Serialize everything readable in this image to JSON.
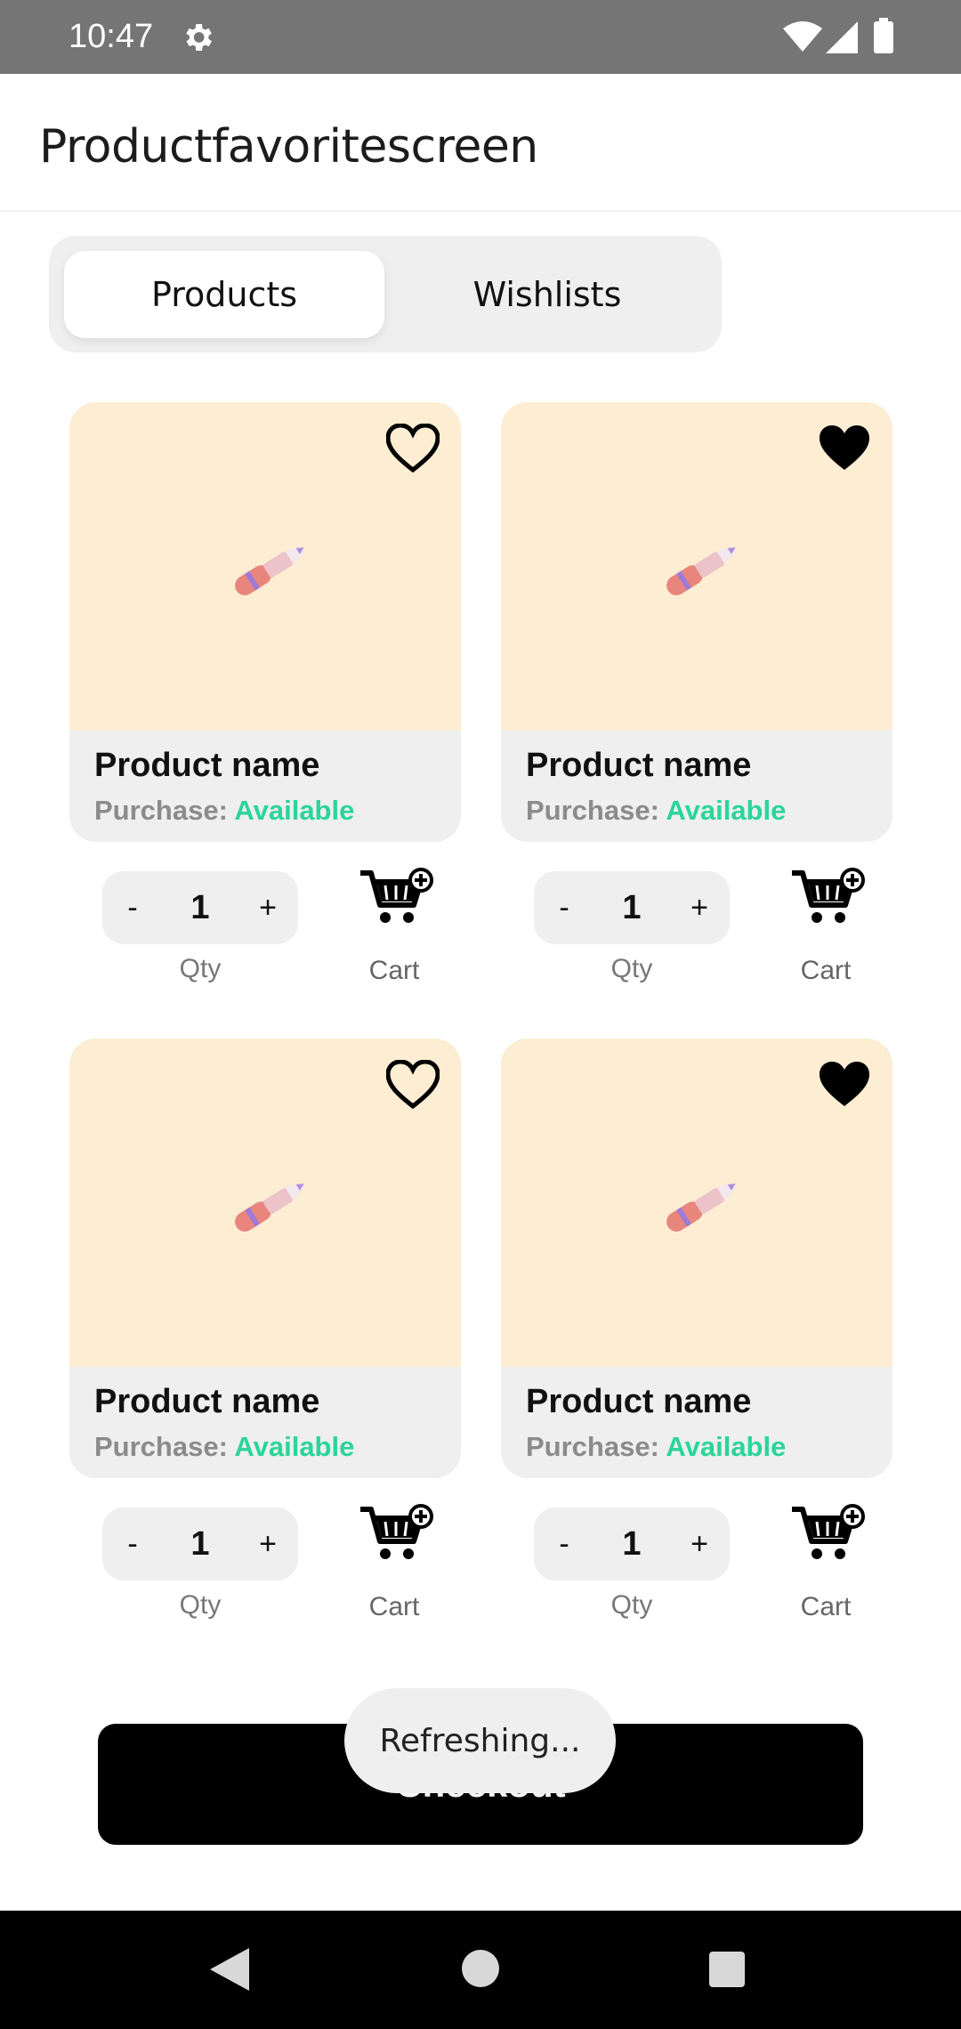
{
  "status_bar": {
    "time": "10:47",
    "icons": [
      "gear-icon",
      "wifi-icon",
      "signal-icon",
      "battery-icon"
    ]
  },
  "app_bar": {
    "title": "Productfavoritescreen"
  },
  "tabs": [
    {
      "label": "Products",
      "selected": true
    },
    {
      "label": "Wishlists",
      "selected": false
    }
  ],
  "products": [
    {
      "name": "Product name",
      "purchase_label": "Purchase:",
      "status": "Available",
      "favorite": false,
      "qty": "1",
      "minus": "-",
      "plus": "+",
      "qty_label": "Qty",
      "cart_label": "Cart"
    },
    {
      "name": "Product name",
      "purchase_label": "Purchase:",
      "status": "Available",
      "favorite": true,
      "qty": "1",
      "minus": "-",
      "plus": "+",
      "qty_label": "Qty",
      "cart_label": "Cart"
    },
    {
      "name": "Product name",
      "purchase_label": "Purchase:",
      "status": "Available",
      "favorite": false,
      "qty": "1",
      "minus": "-",
      "plus": "+",
      "qty_label": "Qty",
      "cart_label": "Cart"
    },
    {
      "name": "Product name",
      "purchase_label": "Purchase:",
      "status": "Available",
      "favorite": true,
      "qty": "1",
      "minus": "-",
      "plus": "+",
      "qty_label": "Qty",
      "cart_label": "Cart"
    }
  ],
  "checkout": {
    "label": "Checkout"
  },
  "toast": {
    "text": "Refreshing..."
  },
  "colors": {
    "status_bar": "#757575",
    "card_image_bg": "#fcedd3",
    "card_bg": "#efefef",
    "available": "#2ad59a",
    "checkout_bg": "#000000"
  }
}
